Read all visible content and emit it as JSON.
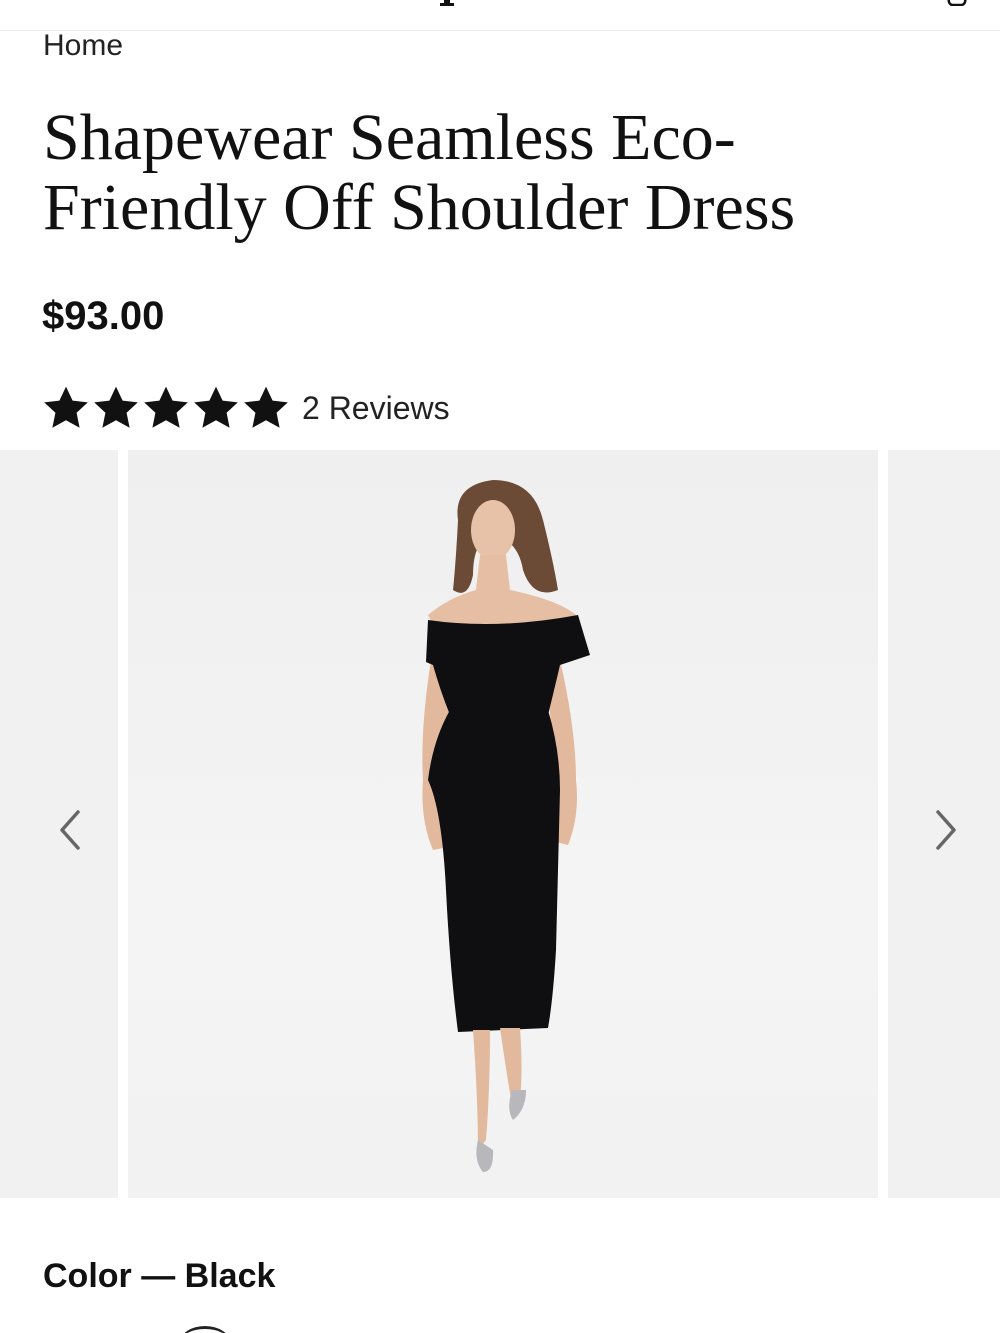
{
  "header": {
    "logo_icon": "brand-logo-fragment",
    "bag_icon": "shopping-bag-icon"
  },
  "breadcrumb": {
    "home_label": "Home"
  },
  "product": {
    "title": "Shapewear Seamless Eco-Friendly Off Shoulder Dress",
    "price": "$93.00",
    "rating": {
      "stars": 5,
      "max_stars": 5,
      "reviews_label": "2 Reviews"
    },
    "color_label": "Color — Black"
  },
  "carousel": {
    "prev_icon": "chevron-left-icon",
    "next_icon": "chevron-right-icon",
    "image_subject": "model-in-black-off-shoulder-dress"
  },
  "colors": {
    "text": "#111111",
    "star": "#111111",
    "image_bg": "#f0f0f0",
    "dress": "#0f0f12",
    "arrow": "#666666"
  }
}
